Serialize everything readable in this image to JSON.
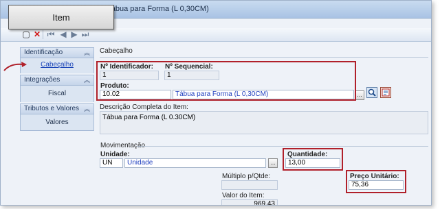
{
  "window": {
    "title": "Tábua para Forma (L 0,30CM)"
  },
  "floating_tab": {
    "label": "Item"
  },
  "toolbar": {
    "new_icon": "new-icon",
    "delete_icon": "delete-icon",
    "first_icon": "first-record-icon",
    "prev_icon": "previous-record-icon",
    "next_icon": "next-record-icon",
    "last_icon": "last-record-icon"
  },
  "sidebar": {
    "groups": [
      {
        "title": "Identificação",
        "items": [
          {
            "label": "Cabeçalho",
            "active": true
          }
        ]
      },
      {
        "title": "Integrações",
        "items": [
          {
            "label": "Fiscal"
          }
        ]
      },
      {
        "title": "Tributos e Valores",
        "items": [
          {
            "label": "Valores"
          }
        ]
      }
    ]
  },
  "header_section": {
    "title": "Cabeçalho",
    "identificador": {
      "label": "Nº Identificador:",
      "value": "1"
    },
    "sequencial": {
      "label": "Nº Sequencial:",
      "value": "1"
    },
    "produto": {
      "label": "Produto:",
      "code": "10.02",
      "description": "Tábua para Forma (L 0,30CM)",
      "lookup_button": "..."
    },
    "descricao_completa": {
      "label": "Descrição Completa do Item:",
      "value": "Tábua para Forma (L 0.30CM)"
    }
  },
  "movimentacao_section": {
    "title": "Movimentação",
    "unidade": {
      "label": "Unidade:",
      "code": "UN",
      "description": "Unidade",
      "lookup_button": "..."
    },
    "quantidade": {
      "label": "Quantidade:",
      "value": "13,00"
    },
    "multiplo": {
      "label": "Múltiplo p/Qtde:",
      "value": ""
    },
    "preco_unitario": {
      "label": "Preço Unitário:",
      "value": "75,36"
    },
    "valor_item": {
      "label": "Valor do Item:",
      "value": "969,43"
    }
  },
  "colors": {
    "highlight": "#b0202a",
    "link": "#1f3fbf",
    "accent": "#a9c3e4"
  }
}
